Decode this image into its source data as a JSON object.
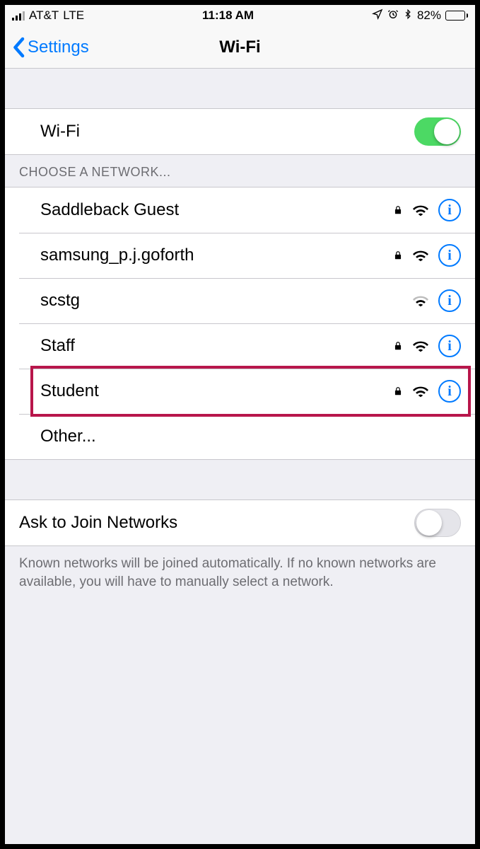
{
  "status": {
    "carrier": "AT&T",
    "network_type": "LTE",
    "time": "11:18 AM",
    "battery_pct": "82%"
  },
  "nav": {
    "back_label": "Settings",
    "title": "Wi-Fi"
  },
  "wifi_toggle": {
    "label": "Wi-Fi",
    "on": true
  },
  "choose_header": "CHOOSE A NETWORK...",
  "networks": [
    {
      "name": "Saddleback Guest",
      "locked": true,
      "signal": 3,
      "highlighted": false
    },
    {
      "name": "samsung_p.j.goforth",
      "locked": true,
      "signal": 3,
      "highlighted": false
    },
    {
      "name": "scstg",
      "locked": false,
      "signal": 2,
      "highlighted": false
    },
    {
      "name": "Staff",
      "locked": true,
      "signal": 3,
      "highlighted": false
    },
    {
      "name": "Student",
      "locked": true,
      "signal": 3,
      "highlighted": true
    }
  ],
  "other_label": "Other...",
  "ask_join": {
    "label": "Ask to Join Networks",
    "on": false,
    "footer": "Known networks will be joined automatically. If no known networks are available, you will have to manually select a network."
  }
}
